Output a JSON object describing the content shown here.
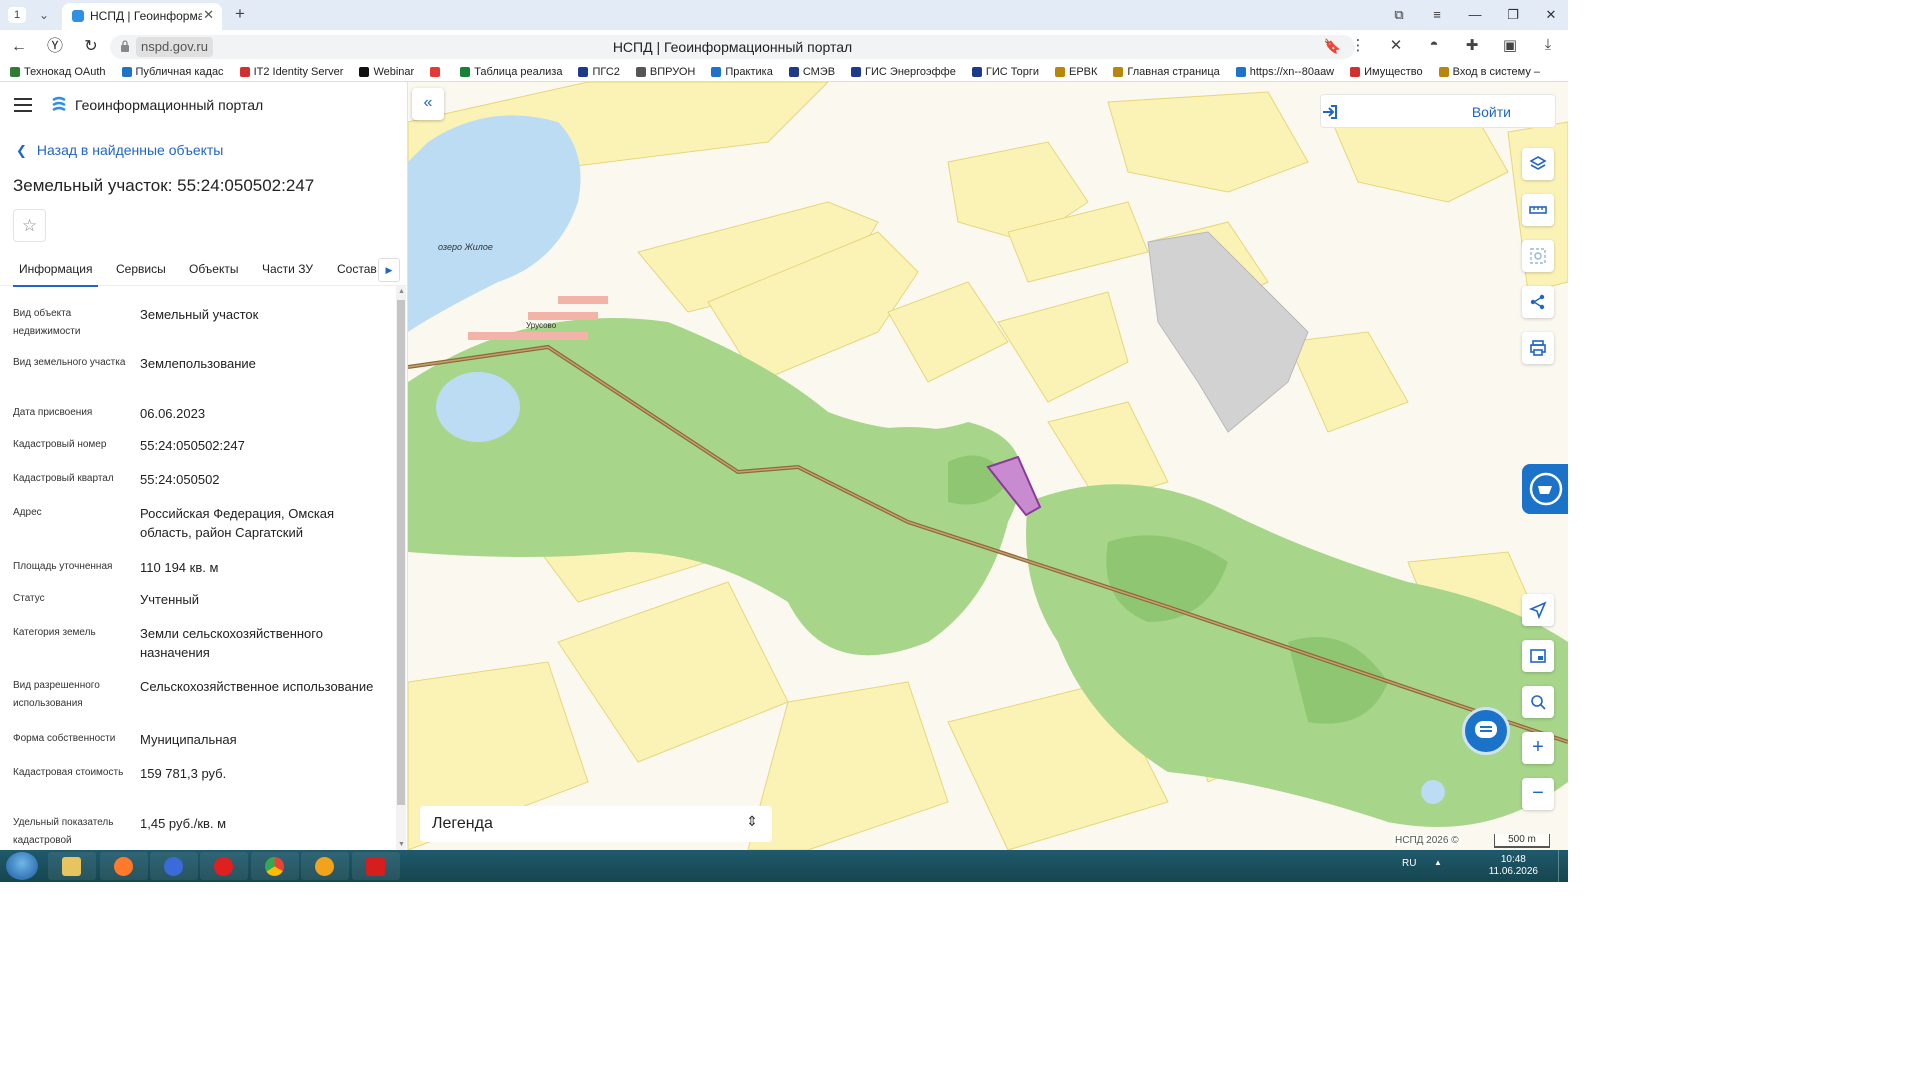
{
  "browser": {
    "tab_index": "1",
    "tab_title": "НСПД | Геоинформацио",
    "url": "nspd.gov.ru",
    "page_title": "НСПД | Геоинформационный портал",
    "bookmarks": [
      {
        "label": "Технокад OAuth",
        "color": "#2f7d32"
      },
      {
        "label": "Публичная кадас",
        "color": "#1e73c8"
      },
      {
        "label": "IT2 Identity Server",
        "color": "#d32f2f"
      },
      {
        "label": "Webinar",
        "color": "#111111"
      },
      {
        "label": "",
        "color": "#e53935"
      },
      {
        "label": "Таблица реализа",
        "color": "#188038"
      },
      {
        "label": "ПГС2",
        "color": "#1e3a8a"
      },
      {
        "label": "ВПРУОН",
        "color": "#555555"
      },
      {
        "label": "Практика",
        "color": "#1e73c8"
      },
      {
        "label": "СМЭВ",
        "color": "#1e3a8a"
      },
      {
        "label": "ГИС Энергоэффе",
        "color": "#1e3a8a"
      },
      {
        "label": "ГИС Торги",
        "color": "#1e3a8a"
      },
      {
        "label": "ЕРВК",
        "color": "#b8860b"
      },
      {
        "label": "Главная страница",
        "color": "#b8860b"
      },
      {
        "label": "https://xn--80aaw",
        "color": "#1e73c8"
      },
      {
        "label": "Имущество",
        "color": "#d32f2f"
      },
      {
        "label": "Вход в систему –",
        "color": "#b8860b"
      }
    ]
  },
  "app": {
    "title": "Геоинформационный портал",
    "back_label": "Назад в найденные объекты",
    "object_title": "Земельный участок: 55:24:050502:247",
    "tabs": [
      "Информация",
      "Сервисы",
      "Объекты",
      "Части ЗУ",
      "Состав"
    ],
    "attributes": [
      {
        "label": "Вид объекта недвижимости",
        "value": "Земельный участок"
      },
      {
        "label": "Вид земельного участка",
        "value": "Землепользование"
      },
      {
        "label": "Дата присвоения",
        "value": "06.06.2023"
      },
      {
        "label": "Кадастровый номер",
        "value": "55:24:050502:247"
      },
      {
        "label": "Кадастровый квартал",
        "value": "55:24:050502"
      },
      {
        "label": "Адрес",
        "value": "Российская Федерация, Омская область, район Саргатский"
      },
      {
        "label": "Площадь уточненная",
        "value": "110 194 кв. м"
      },
      {
        "label": "Статус",
        "value": "Учтенный"
      },
      {
        "label": "Категория земель",
        "value": "Земли сельскохозяйственного назначения"
      },
      {
        "label": "Вид разрешенного использования",
        "value": "Сельскохозяйственное использование"
      },
      {
        "label": "Форма собственности",
        "value": "Муниципальная"
      },
      {
        "label": "Кадастровая стоимость",
        "value": "159 781,3 руб."
      },
      {
        "label": "Удельный показатель кадастровой",
        "value": "1,45 руб./кв. м"
      }
    ]
  },
  "map": {
    "login_label": "Войти",
    "legend_label": "Легенда",
    "lake_label": "озеро Жилое",
    "village_label": "Урусово",
    "copyright": "НСПД 2026 ©",
    "scale_label": "500 m",
    "colors": {
      "field": "#fbf3b6",
      "field_border": "#e6d67a",
      "forest": "#a7d58a",
      "forest_dark": "#8ec671",
      "water": "#bcdcf4",
      "road": "#8a6a3e",
      "parcel": "#c88bd0",
      "restricted": "#d2d2d2"
    }
  },
  "taskbar": {
    "lang": "RU",
    "time": "10:48",
    "date": "11.06.2026"
  }
}
